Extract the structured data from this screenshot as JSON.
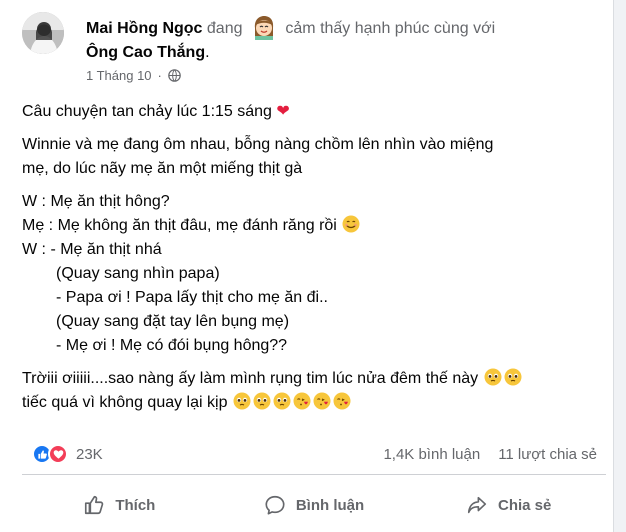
{
  "post": {
    "author": "Mai Hồng Ngọc",
    "feeling_prefix": "đang",
    "feeling_text": "cảm thấy hạnh phúc cùng với",
    "tagged": "Ông Cao Thắng",
    "tagged_suffix": ".",
    "timestamp": "1 Tháng 10",
    "privacy_icon": "globe-icon",
    "lines": {
      "l1": "Câu chuyện tan chảy lúc 1:15 sáng",
      "l2a": "Winnie và mẹ đang ôm nhau, bỗng nàng chồm lên nhìn vào miệng",
      "l2b": "mẹ, do lúc nãy mẹ ăn một miếng thịt gà",
      "l3": "W : Mẹ ăn thịt hông?",
      "l4": "Mẹ : Mẹ không ăn thịt đâu, mẹ đánh răng rồi",
      "l5": "W : - Mẹ ăn thịt nhá",
      "l6": "(Quay sang nhìn papa)",
      "l7": "- Papa ơi ! Papa lấy thịt cho mẹ ăn đi..",
      "l8": "(Quay sang đặt tay lên bụng mẹ)",
      "l9": "- Mẹ ơi ! Mẹ có đói bụng hông??",
      "l10": "Trờiii ơiiiii....sao nàng ấy làm mình rụng tim lúc nửa đêm thế này",
      "l11": "tiếc quá vì không quay lại kịp"
    }
  },
  "engagement": {
    "reaction_count": "23K",
    "comments": "1,4K bình luận",
    "shares": "11 lượt chia sẻ",
    "reaction_icons": [
      "like-icon",
      "love-icon"
    ]
  },
  "actions": {
    "like": "Thích",
    "comment": "Bình luận",
    "share": "Chia sẻ"
  },
  "colors": {
    "facebook_blue": "#1877f2",
    "love_red": "#f33e58",
    "secondary_text": "#65676b"
  }
}
